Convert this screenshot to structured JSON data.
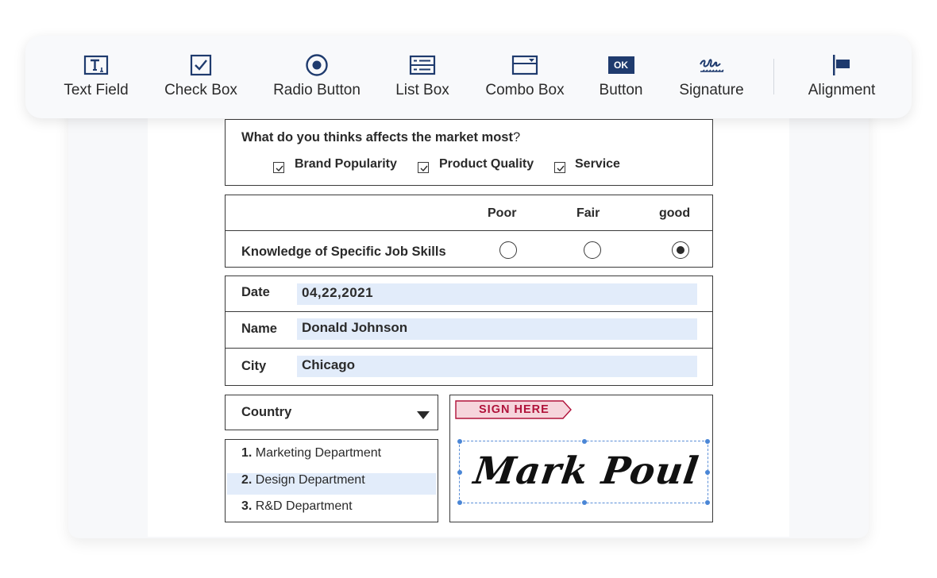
{
  "toolbar": {
    "tools": [
      {
        "label": "Text Field",
        "icon": "text-field-icon"
      },
      {
        "label": "Check Box",
        "icon": "check-box-icon"
      },
      {
        "label": "Radio Button",
        "icon": "radio-button-icon"
      },
      {
        "label": "List Box",
        "icon": "list-box-icon"
      },
      {
        "label": "Combo Box",
        "icon": "combo-box-icon"
      },
      {
        "label": "Button",
        "icon": "button-icon",
        "icon_text": "OK"
      },
      {
        "label": "Signature",
        "icon": "signature-icon"
      },
      {
        "label": "Alignment",
        "icon": "alignment-icon"
      }
    ]
  },
  "form": {
    "question": {
      "text_bold": "What do you thinks affects the market most",
      "text_suffix": "?",
      "options": [
        {
          "label": "Brand Popularity",
          "checked": true
        },
        {
          "label": "Product Quality",
          "checked": true
        },
        {
          "label": "Service",
          "checked": true
        }
      ]
    },
    "rating": {
      "columns": [
        "Poor",
        "Fair",
        "good"
      ],
      "row_label": "Knowledge of Specific Job Skills",
      "selected": "good"
    },
    "fields": [
      {
        "label": "Date",
        "value": "04,22,2021"
      },
      {
        "label": "Name",
        "value": "Donald Johnson"
      },
      {
        "label": "City",
        "value": "Chicago"
      }
    ],
    "combo": {
      "label": "Country"
    },
    "listbox": {
      "items": [
        {
          "num": "1.",
          "label": "Marketing Department",
          "selected": false
        },
        {
          "num": "2.",
          "label": "Design Department",
          "selected": true
        },
        {
          "num": "3.",
          "label": "R&D Department",
          "selected": false
        }
      ]
    },
    "signature": {
      "tag": "SIGN HERE",
      "signed_name": "Mark Poul"
    }
  },
  "colors": {
    "accent_navy": "#1f3b6e",
    "field_fill": "#e2ecfa",
    "sign_tag_fill": "#f6d5dc",
    "sign_tag_text": "#b0123a",
    "selection_blue": "#4a86d6"
  }
}
